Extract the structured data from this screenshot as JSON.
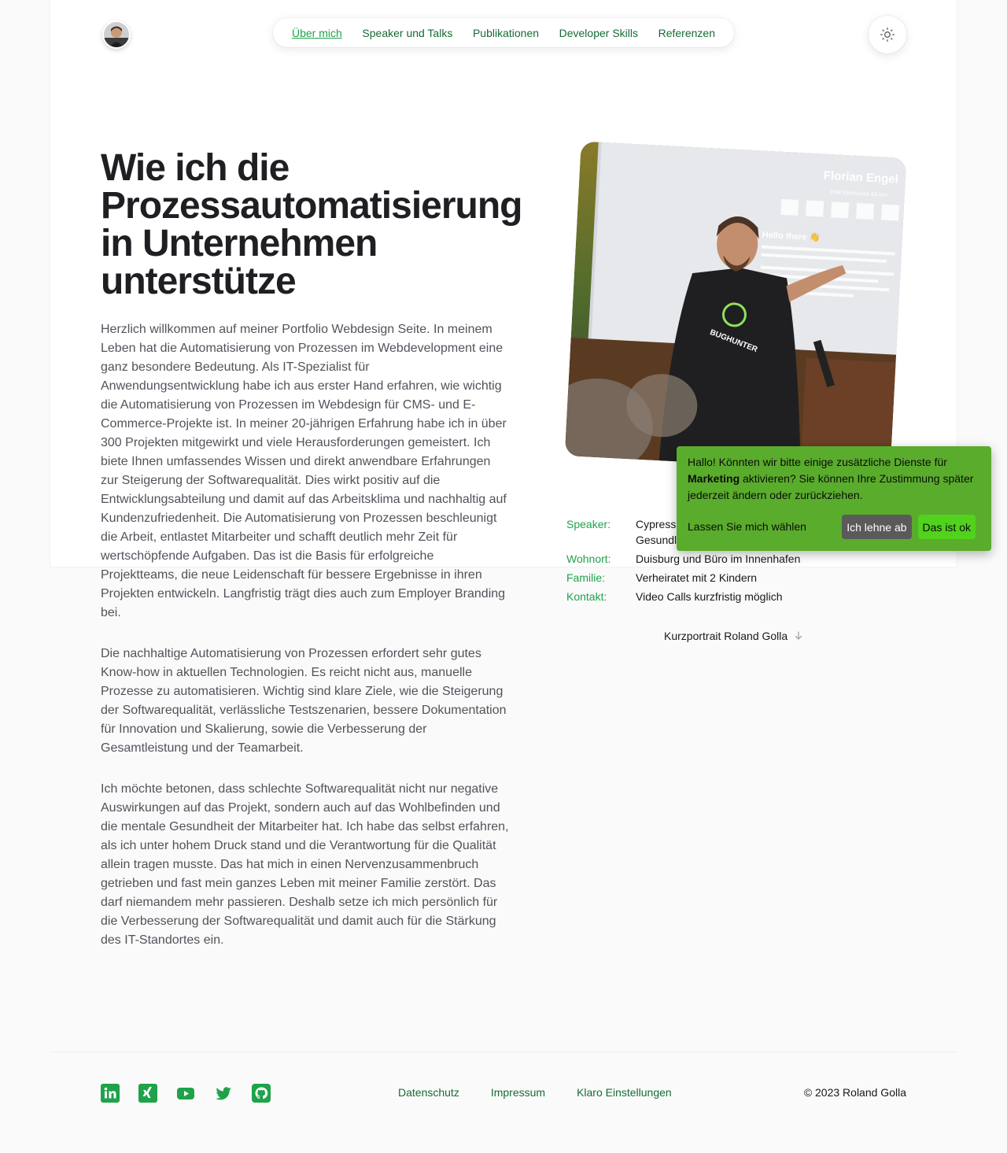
{
  "header": {
    "nav": [
      {
        "label": "Über mich",
        "active": true
      },
      {
        "label": "Speaker und Talks",
        "active": false
      },
      {
        "label": "Publikationen",
        "active": false
      },
      {
        "label": "Developer Skills",
        "active": false
      },
      {
        "label": "Referenzen",
        "active": false
      }
    ],
    "theme_icon": "sun-icon"
  },
  "hero": {
    "headline": "Wie ich die Prozessautomatisierung in Unternehmen unterstütze",
    "paragraphs": [
      "Herzlich willkommen auf meiner Portfolio Webdesign Seite. In meinem Leben hat die Automatisierung von Prozessen im Webdevelopment eine ganz besondere Bedeutung. Als IT-Spezialist für Anwendungsentwicklung habe ich aus erster Hand erfahren, wie wichtig die Automatisierung von Prozessen im Webdesign für CMS- und E-Commerce-Projekte ist. In meiner 20-jährigen Erfahrung habe ich in über 300 Projekten mitgewirkt und viele Herausforderungen gemeistert. Ich biete Ihnen umfassendes Wissen und direkt anwendbare Erfahrungen zur Steigerung der Softwarequalität. Dies wirkt positiv auf die Entwicklungsabteilung und damit auf das Arbeitsklima und nachhaltig auf Kundenzufriedenheit. Die Automatisierung von Prozessen beschleunigt die Arbeit, entlastet Mitarbeiter und schafft deutlich mehr Zeit für wertschöpfende Aufgaben. Das ist die Basis für erfolgreiche Projektteams, die neue Leidenschaft für bessere Ergebnisse in ihren Projekten entwickeln. Langfristig trägt dies auch zum Employer Branding bei.",
      "Die nachhaltige Automatisierung von Prozessen erfordert sehr gutes Know-how in aktuellen Technologien. Es reicht nicht aus, manuelle Prozesse zu automatisieren. Wichtig sind klare Ziele, wie die Steigerung der Softwarequalität, verlässliche Testszenarien, bessere Dokumentation für Innovation und Skalierung, sowie die Verbesserung der Gesamtleistung und der Teamarbeit.",
      "Ich möchte betonen, dass schlechte Softwarequalität nicht nur negative Auswirkungen auf das Projekt, sondern auch auf das Wohlbefinden und die mentale Gesundheit der Mitarbeiter hat. Ich habe das selbst erfahren, als ich unter hohem Druck stand und die Verantwortung für die Qualität allein tragen musste. Das hat mich in einen Nervenzusammenbruch getrieben und fast mein ganzes Leben mit meiner Familie zerstört. Das darf niemandem mehr passieren. Deshalb setze ich mich persönlich für die Verbesserung der Softwarequalität und damit auch für die Stärkung des IT-Standortes ein."
    ]
  },
  "photo": {
    "slide_name": "Florian Engel",
    "slide_subtitle": "PHP Enthusiast && pro",
    "slide_heading": "Hello there 👋",
    "shirt_text": "BUGHUNTER"
  },
  "info": [
    {
      "key": "Speaker:",
      "value": "Cypress ... Gesundh..."
    },
    {
      "key": "Wohnort:",
      "value": "Duisburg und Büro im Innenhafen"
    },
    {
      "key": "Familie:",
      "value": "Verheiratet mit 2 Kindern"
    },
    {
      "key": "Kontakt:",
      "value": "Video Calls kurzfristig möglich"
    }
  ],
  "info_speaker_line1": "Cypress",
  "info_speaker_line2": "Gesundl",
  "portrait_link": "Kurzportrait Roland Golla",
  "consent": {
    "text_before": "Hallo! Könnten wir bitte einige zusätzliche Dienste für ",
    "text_bold": "Marketing",
    "text_after": " aktivieren? Sie können Ihre Zustimmung später jederzeit ändern oder zurückziehen.",
    "learn_more": "Lassen Sie mich wählen",
    "decline": "Ich lehne ab",
    "accept": "Das ist ok"
  },
  "footer": {
    "social_icons": [
      "linkedin-icon",
      "xing-icon",
      "youtube-icon",
      "twitter-icon",
      "github-icon"
    ],
    "links": [
      "Datenschutz",
      "Impressum",
      "Klaro Einstellungen"
    ],
    "copyright": "© 2023 Roland Golla"
  },
  "colors": {
    "accent": "#1fa24a",
    "nav_link": "#176b35",
    "consent_bg": "#5aac2c",
    "accept_bg": "#51d21c",
    "decline_bg": "#5a5a5a"
  }
}
